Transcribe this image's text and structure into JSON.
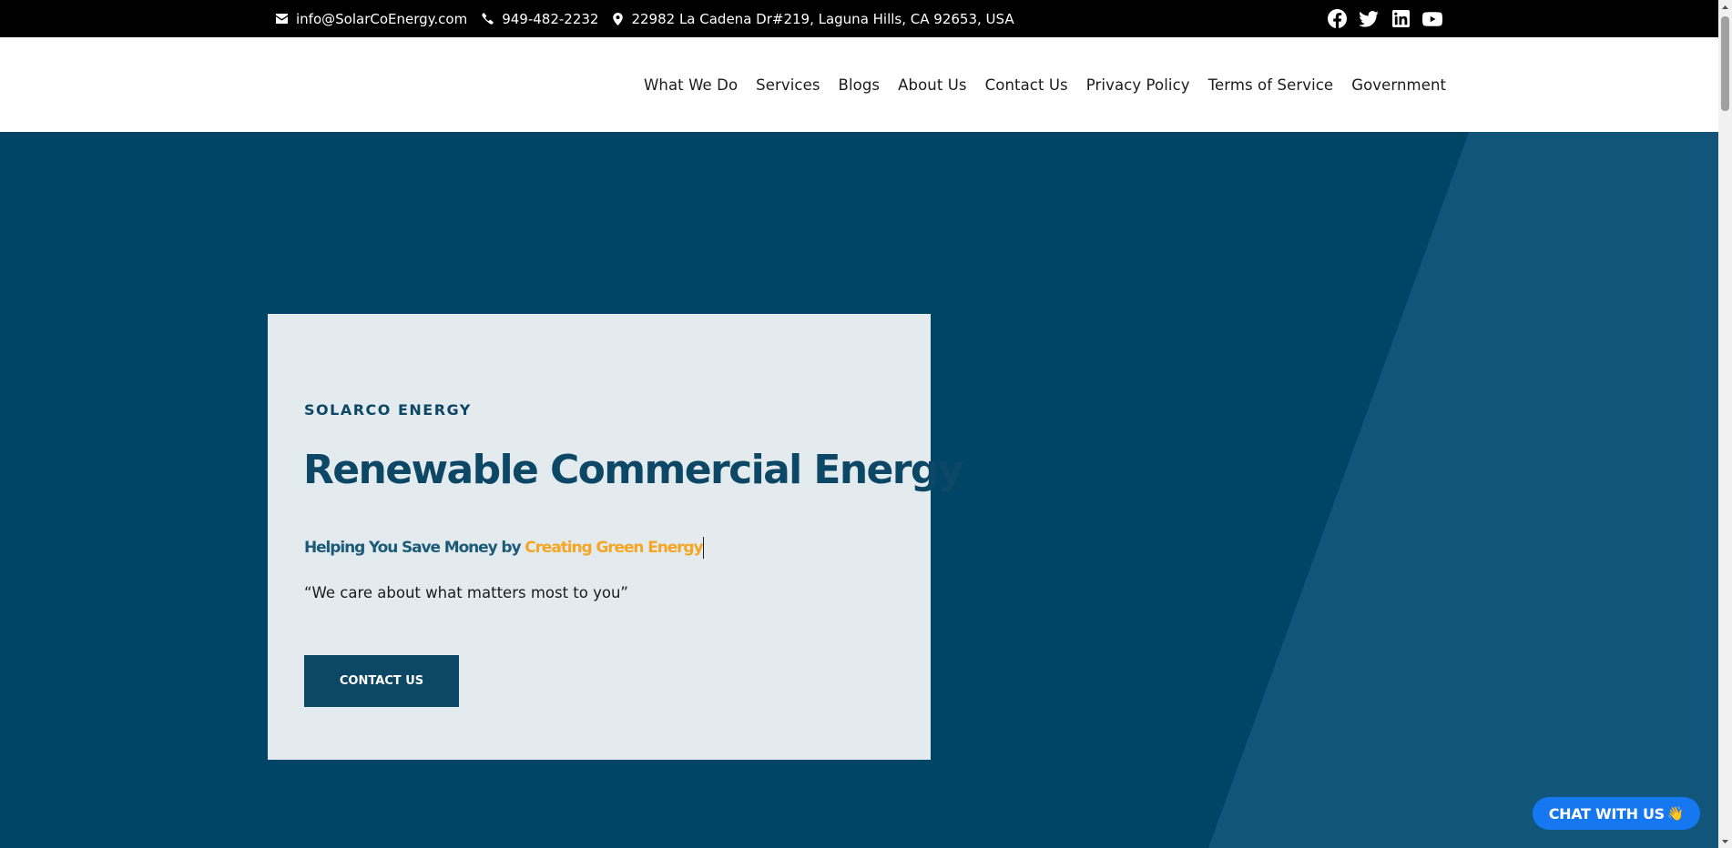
{
  "topbar": {
    "email": "info@SolarCoEnergy.com",
    "phone": "949-482-2232",
    "address": "22982 La Cadena Dr#219, Laguna Hills, CA 92653, USA",
    "contact_icons": [
      "envelope-icon",
      "phone-icon",
      "map-pin-icon"
    ],
    "social_icons": [
      "facebook-icon",
      "twitter-icon",
      "linkedin-icon",
      "youtube-icon"
    ]
  },
  "nav": {
    "items": [
      "What We Do",
      "Services",
      "Blogs",
      "About Us",
      "Contact Us",
      "Privacy Policy",
      "Terms of Service",
      "Government"
    ]
  },
  "hero": {
    "eyebrow": "SOLARCO ENERGY",
    "title": "Renewable Commercial Energy",
    "subtitle_main": "Helping You Save Money by ",
    "subtitle_accent": "Creating Green Energy",
    "quote": "“We care about what matters most to you”",
    "cta_label": "CONTACT US"
  },
  "chat": {
    "label": "CHAT WITH US",
    "emoji": "👋"
  },
  "colors": {
    "topbar_bg": "#000000",
    "hero_bg": "#004466",
    "hero_stripe": "#12557a",
    "card_bg": "#e4ebef",
    "brand_navy": "#0d4766",
    "accent_orange": "#f5a623",
    "chat_blue": "#1578f0"
  }
}
